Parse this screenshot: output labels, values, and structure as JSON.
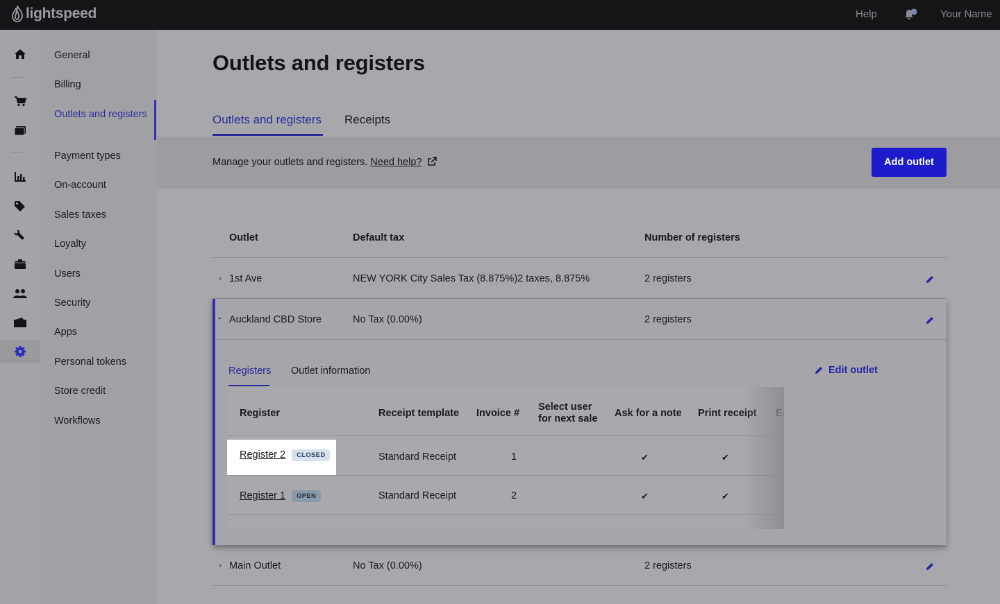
{
  "topbar": {
    "logo_text": "lightspeed",
    "help": "Help",
    "user_name": "Your Name"
  },
  "rail": {
    "icons": [
      "home-icon",
      "cart-icon",
      "register-icon",
      "chart-icon",
      "tag-icon",
      "wrench-icon",
      "box-icon",
      "users-icon",
      "wallet-icon",
      "gear-icon"
    ],
    "active": "gear-icon"
  },
  "subnav": {
    "items": [
      {
        "label": "General"
      },
      {
        "label": "Billing"
      },
      {
        "label": "Outlets and registers",
        "active": true
      },
      {
        "label": "Payment types"
      },
      {
        "label": "On-account"
      },
      {
        "label": "Sales taxes"
      },
      {
        "label": "Loyalty"
      },
      {
        "label": "Users"
      },
      {
        "label": "Security"
      },
      {
        "label": "Apps"
      },
      {
        "label": "Personal tokens"
      },
      {
        "label": "Store credit"
      },
      {
        "label": "Workflows"
      }
    ]
  },
  "page": {
    "title": "Outlets and registers",
    "tabs": [
      {
        "label": "Outlets and registers",
        "active": true
      },
      {
        "label": "Receipts"
      }
    ],
    "info": "Manage your outlets and registers.",
    "help_link": "Need help?",
    "add_outlet": "Add outlet"
  },
  "outlets": {
    "headers": {
      "outlet": "Outlet",
      "default_tax": "Default tax",
      "registers": "Number of registers"
    },
    "rows": [
      {
        "name": "1st Ave",
        "tax": "NEW YORK City Sales Tax (8.875%)2 taxes, 8.875%",
        "registers": "2 registers",
        "expanded": false
      },
      {
        "name": "Auckland CBD Store",
        "tax": "No Tax (0.00%)",
        "registers": "2 registers",
        "expanded": true
      },
      {
        "name": "Main Outlet",
        "tax": "No Tax (0.00%)",
        "registers": "2 registers",
        "expanded": false
      }
    ]
  },
  "expanded_outlet": {
    "tabs": [
      {
        "label": "Registers",
        "active": true
      },
      {
        "label": "Outlet information"
      }
    ],
    "edit_outlet": "Edit outlet",
    "register_headers": {
      "register": "Register",
      "receipt_template": "Receipt template",
      "invoice": "Invoice #",
      "select_user": "Select user for next sale",
      "ask_note": "Ask for a note",
      "print_receipt": "Print receipt",
      "email": "Er"
    },
    "registers": [
      {
        "name": "Register 2",
        "status": "CLOSED",
        "template": "Standard Receipt",
        "invoice": "1",
        "ask_note": "✔",
        "print_receipt": "✔"
      },
      {
        "name": "Register 1",
        "status": "OPEN",
        "template": "Standard Receipt",
        "invoice": "2",
        "ask_note": "✔",
        "print_receipt": "✔"
      }
    ]
  },
  "colors": {
    "accent": "#2a2a98",
    "primary_button": "#1c1ccc",
    "topbar": "#151518"
  }
}
